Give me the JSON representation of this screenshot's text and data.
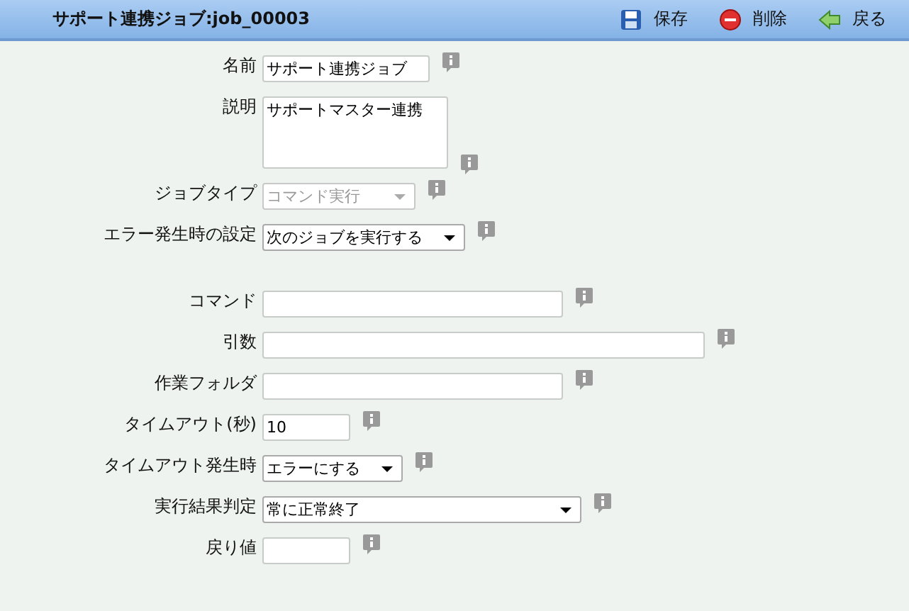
{
  "window": {
    "title": "サポート連携ジョブ:job_00003"
  },
  "toolbar": [
    {
      "kind": "save",
      "label": "保存"
    },
    {
      "kind": "delete",
      "label": "削除"
    },
    {
      "kind": "back",
      "label": "戻る"
    }
  ],
  "fields": [
    {
      "label": "名前",
      "kind": "text",
      "value": "サポート連携ジョブ"
    },
    {
      "label": "説明",
      "kind": "textarea",
      "value": "サポートマスター連携"
    },
    {
      "label": "ジョブタイプ",
      "kind": "select",
      "value": "コマンド実行",
      "disabled": true
    },
    {
      "label": "エラー発生時の設定",
      "kind": "select",
      "value": "次のジョブを実行する",
      "disabled": false
    },
    {
      "label": "コマンド",
      "kind": "text"
    },
    {
      "label": "引数",
      "kind": "text"
    },
    {
      "label": "作業フォルダ",
      "kind": "text"
    },
    {
      "label": "タイムアウト(秒)",
      "kind": "text",
      "value": "10"
    },
    {
      "label": "タイムアウト発生時",
      "kind": "select",
      "value": "エラーにする",
      "disabled": false
    },
    {
      "label": "実行結果判定",
      "kind": "select",
      "value": "常に正常終了",
      "disabled": false
    },
    {
      "label": "戻り値",
      "kind": "text"
    }
  ]
}
